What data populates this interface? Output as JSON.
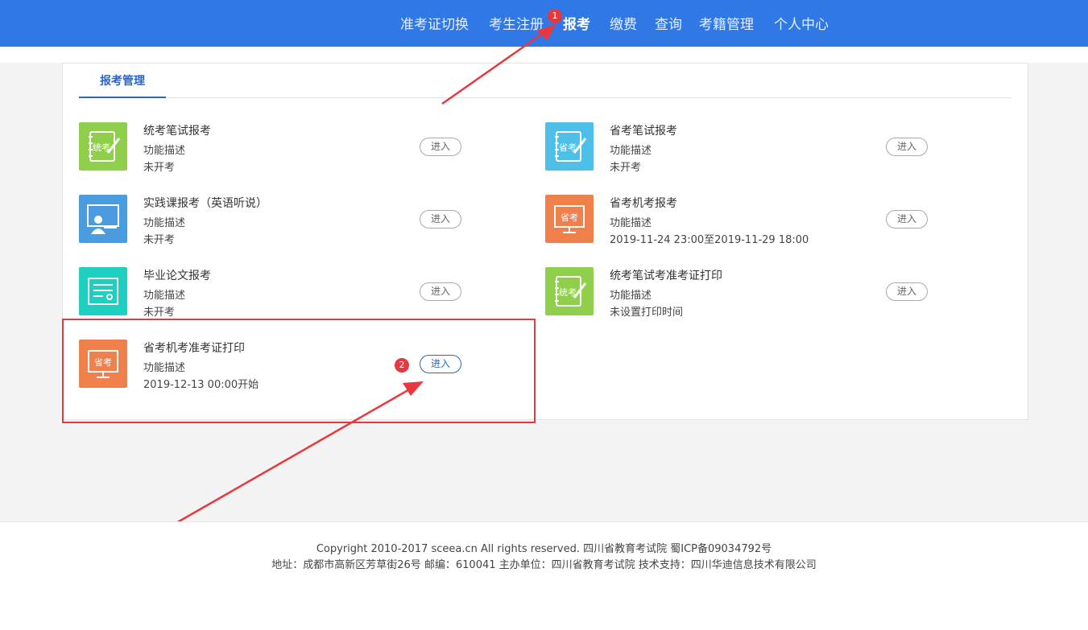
{
  "nav": {
    "items": [
      {
        "label": "准考证切换"
      },
      {
        "label": "考生注册"
      },
      {
        "label": "报考"
      },
      {
        "label": "缴费"
      },
      {
        "label": "查询"
      },
      {
        "label": "考籍管理"
      },
      {
        "label": "个人中心"
      }
    ],
    "active": "报考"
  },
  "panel": {
    "tab_label": "报考管理",
    "cards": [
      {
        "title": "统考笔试报考",
        "desc": "功能描述",
        "status": "未开考",
        "button": "进入",
        "icon": "tongkao-book-icon",
        "icon_text": "统考",
        "color": "#8fcf4c"
      },
      {
        "title": "省考笔试报考",
        "desc": "功能描述",
        "status": "未开考",
        "button": "进入",
        "icon": "shengkao-book-icon",
        "icon_text": "省考",
        "color": "#4ebfe8"
      },
      {
        "title": "实践课报考（英语听说）",
        "desc": "功能描述",
        "status": "未开考",
        "button": "进入",
        "icon": "teacher-board-icon",
        "color": "#4a9be0"
      },
      {
        "title": "省考机考报考",
        "desc": "功能描述",
        "status": "2019-11-24 23:00至2019-11-29 18:00",
        "button": "进入",
        "icon": "shengkao-monitor-icon",
        "icon_text": "省考",
        "color": "#f0804b"
      },
      {
        "title": "毕业论文报考",
        "desc": "功能描述",
        "status": "未开考",
        "button": "进入",
        "icon": "certificate-icon",
        "color": "#1fcfbf"
      },
      {
        "title": "统考笔试考准考证打印",
        "desc": "功能描述",
        "status": "未设置打印时间",
        "button": "进入",
        "icon": "tongkao-book-icon",
        "icon_text": "统考",
        "color": "#8fcf4c"
      },
      {
        "title": "省考机考准考证打印",
        "desc": "功能描述",
        "status": "2019-12-13 00:00开始",
        "button": "进入",
        "icon": "shengkao-monitor-icon",
        "icon_text": "省考",
        "color": "#f0804b"
      }
    ]
  },
  "annotations": {
    "badge1": "1",
    "badge2": "2",
    "arrow_color": "#e8383d"
  },
  "footer": {
    "line1": "Copyright 2010-2017 sceea.cn All rights reserved. 四川省教育考试院 蜀ICP备09034792号",
    "line2": "地址：成都市高新区芳草街26号 邮编：610041 主办单位：四川省教育考试院 技术支持：四川华迪信息技术有限公司"
  }
}
